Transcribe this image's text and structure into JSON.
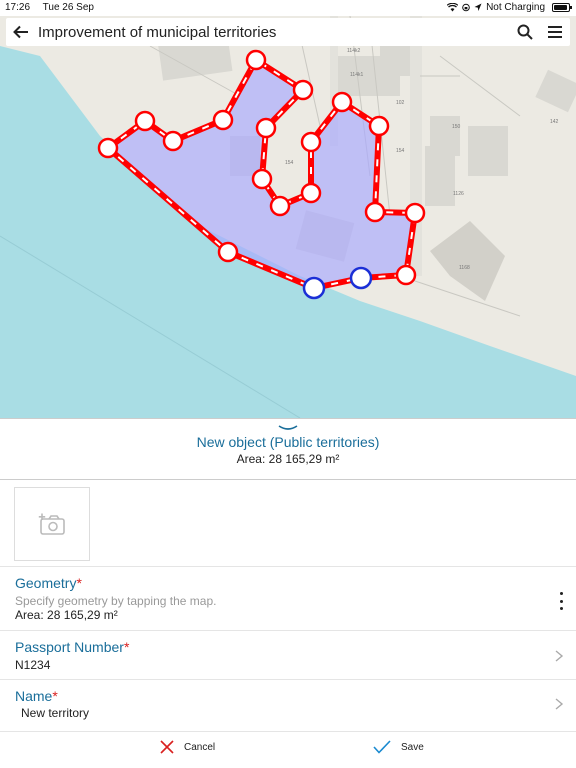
{
  "status_bar": {
    "time": "17:26",
    "date": "Tue 26 Sep",
    "charging": "Not Charging"
  },
  "toolbar": {
    "title": "Improvement of municipal territories",
    "back_icon": "arrow-left-icon",
    "search_icon": "search-icon",
    "menu_icon": "hamburger-menu-icon"
  },
  "map": {
    "water_color": "#a9dde4",
    "land_color": "#eceae3",
    "polygon_fill": "#a8a8ff",
    "polygon_stroke": "#ff0000",
    "vertex_selected_color": "#1b2fd6",
    "labels": [
      "114k2",
      "114k1",
      "154",
      "150",
      "154",
      "142",
      "102",
      "1168",
      "1126"
    ]
  },
  "sheet": {
    "object_title": "New object (Public territories)",
    "area_text": "Area: 28 165,29  m²"
  },
  "form": {
    "photo_icon": "add-photo-icon",
    "geometry": {
      "label": "Geometry",
      "required_mark": "*",
      "hint": "Specify geometry by tapping the map.",
      "value": "Area: 28 165,29  m²"
    },
    "passport": {
      "label": "Passport Number",
      "required_mark": "*",
      "value": "N1234"
    },
    "name": {
      "label": "Name",
      "required_mark": "*",
      "value": "New territory"
    }
  },
  "actions": {
    "cancel": "Cancel",
    "save": "Save",
    "cancel_color": "#d9201f",
    "save_color": "#1a8ad0"
  }
}
